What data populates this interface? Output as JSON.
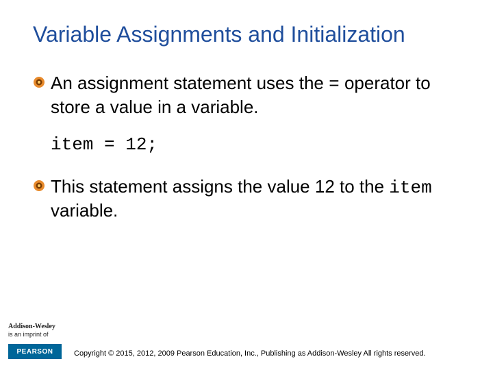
{
  "title": "Variable Assignments and Initialization",
  "bullets": [
    {
      "pre": "An assignment statement uses the ",
      "code": "=",
      "post": " operator to store a value in a variable."
    },
    {
      "pre": "This statement assigns the value 12 to the ",
      "code": "item",
      "post": " variable."
    }
  ],
  "code_block": "item = 12;",
  "footer": {
    "imprint_name": "Addison-Wesley",
    "imprint_tag": "is an imprint of",
    "pearson": "PEARSON",
    "copyright": "Copyright © 2015, 2012, 2009 Pearson Education, Inc., Publishing as Addison-Wesley All rights reserved."
  }
}
